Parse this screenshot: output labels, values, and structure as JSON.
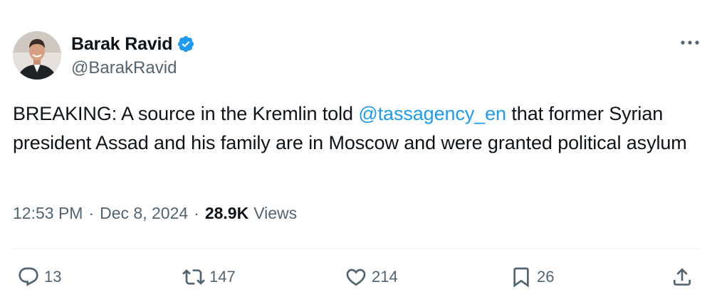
{
  "author": {
    "display_name": "Barak Ravid",
    "handle": "@BarakRavid",
    "verified": true,
    "avatar_icon": "profile-photo"
  },
  "tweet": {
    "text_before": "BREAKING: A source in the Kremlin told ",
    "mention": "@tassagency_en",
    "text_after": " that former Syrian president Assad and his family are in Moscow and were granted political asylum"
  },
  "meta": {
    "time": "12:53 PM",
    "separator": "·",
    "date": "Dec 8, 2024",
    "views_count": "28.9K",
    "views_label": "Views"
  },
  "actions": {
    "reply_count": "13",
    "repost_count": "147",
    "like_count": "214",
    "bookmark_count": "26"
  },
  "icons": {
    "more": "more-horizontal-icon",
    "reply": "reply-icon",
    "repost": "repost-icon",
    "like": "heart-icon",
    "bookmark": "bookmark-icon",
    "share": "share-icon",
    "verified": "verified-badge-icon"
  },
  "colors": {
    "accent": "#1d9bf0",
    "text_primary": "#0f1419",
    "text_secondary": "#536471",
    "divider": "#eff3f4"
  }
}
